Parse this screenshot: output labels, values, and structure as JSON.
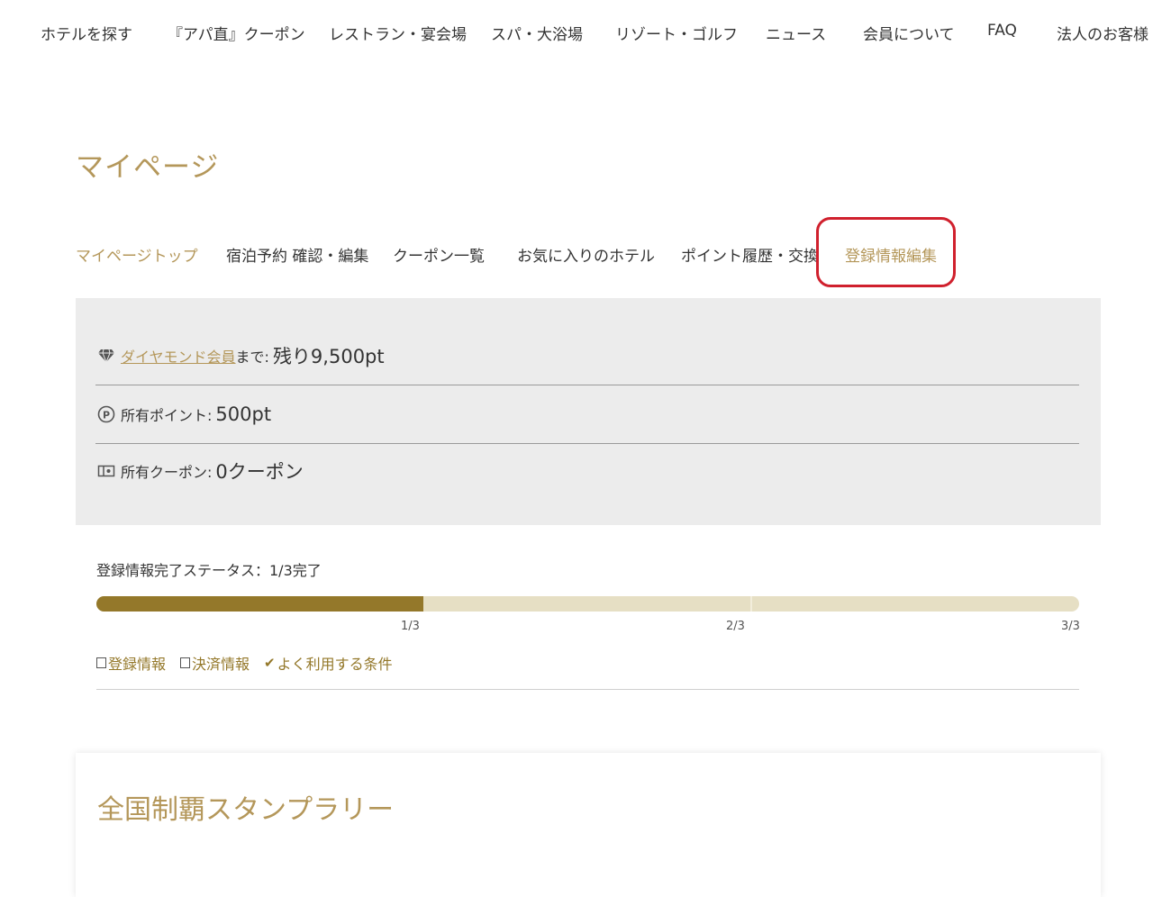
{
  "global_nav": {
    "items": [
      "ホテルを探す",
      "『アパ直』クーポン",
      "レストラン・宴会場",
      "スパ・大浴場",
      "リゾート・ゴルフ",
      "ニュース",
      "会員について",
      "FAQ",
      "法人のお客様"
    ]
  },
  "page_title": "マイページ",
  "tabs": [
    "マイページトップ",
    "宿泊予約 確認・編集",
    "クーポン一覧",
    "お気に入りのホテル",
    "ポイント履歴・交換",
    "登録情報編集"
  ],
  "active_tabs": [
    "マイページトップ",
    "登録情報編集"
  ],
  "points": {
    "rank_link": "ダイヤモンド会員",
    "rank_suffix": "まで:",
    "rank_remaining": "残り9,500pt",
    "owned_points_label": "所有ポイント:",
    "owned_points_value": "500pt",
    "owned_coupons_label": "所有クーポン:",
    "owned_coupons_value": "0クーポン"
  },
  "status": {
    "label": "登録情報完了ステータス：1/3完了",
    "progress_fraction": 0.333,
    "ticks": [
      "1/3",
      "2/3",
      "3/3"
    ],
    "checklist": [
      {
        "label": "登録情報",
        "done": false
      },
      {
        "label": "決済情報",
        "done": false
      },
      {
        "label": "よく利用する条件",
        "done": true
      }
    ]
  },
  "stamp_rally": {
    "title": "全国制覇スタンプラリー"
  },
  "colors": {
    "gold": "#b4975a",
    "progress_fill": "#94782a",
    "progress_track": "#e6dfc4",
    "highlight_red": "#d0202d",
    "panel_bg": "#ececec"
  },
  "icons": {
    "rank": "diamond-icon",
    "points": "point-p-icon",
    "coupons": "coupon-icon"
  }
}
